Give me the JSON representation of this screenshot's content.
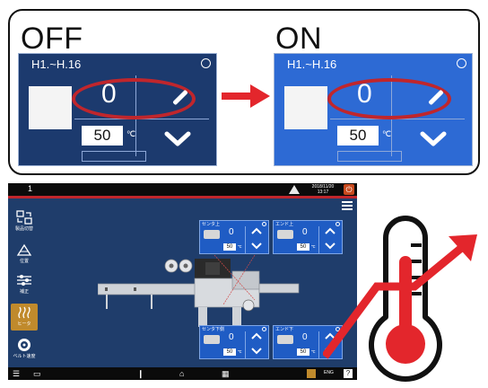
{
  "compare": {
    "off_label": "OFF",
    "on_label": "ON",
    "panel_title": "H1.~H.16",
    "current_value": "0",
    "setpoint": "50",
    "unit": "℃"
  },
  "hmi": {
    "screen_number": "1",
    "datetime": "2018/11/20 13:17",
    "sidebar": [
      {
        "label": "製品切替",
        "icon": "product-switch-icon"
      },
      {
        "label": "位置",
        "icon": "position-icon"
      },
      {
        "label": "補正",
        "icon": "correction-icon"
      },
      {
        "label": "ヒータ",
        "icon": "heater-icon",
        "active": true
      },
      {
        "label": "ベルト速度",
        "icon": "speed-icon"
      }
    ],
    "heaters": [
      {
        "title": "センタ上",
        "value": "0",
        "setpoint": "50",
        "unit": "℃"
      },
      {
        "title": "エンド上",
        "value": "0",
        "setpoint": "50",
        "unit": "℃"
      },
      {
        "title": "センタ下側",
        "value": "0",
        "setpoint": "50",
        "unit": "℃"
      },
      {
        "title": "エンド下",
        "value": "0",
        "setpoint": "50",
        "unit": "℃"
      }
    ],
    "bottom": {
      "language": "ENG",
      "help": "?"
    }
  },
  "colors": {
    "off_panel": "#1c3a6e",
    "on_panel": "#2d6ad4",
    "highlight_red": "#c0262c",
    "arrow_red": "#e3262c"
  }
}
